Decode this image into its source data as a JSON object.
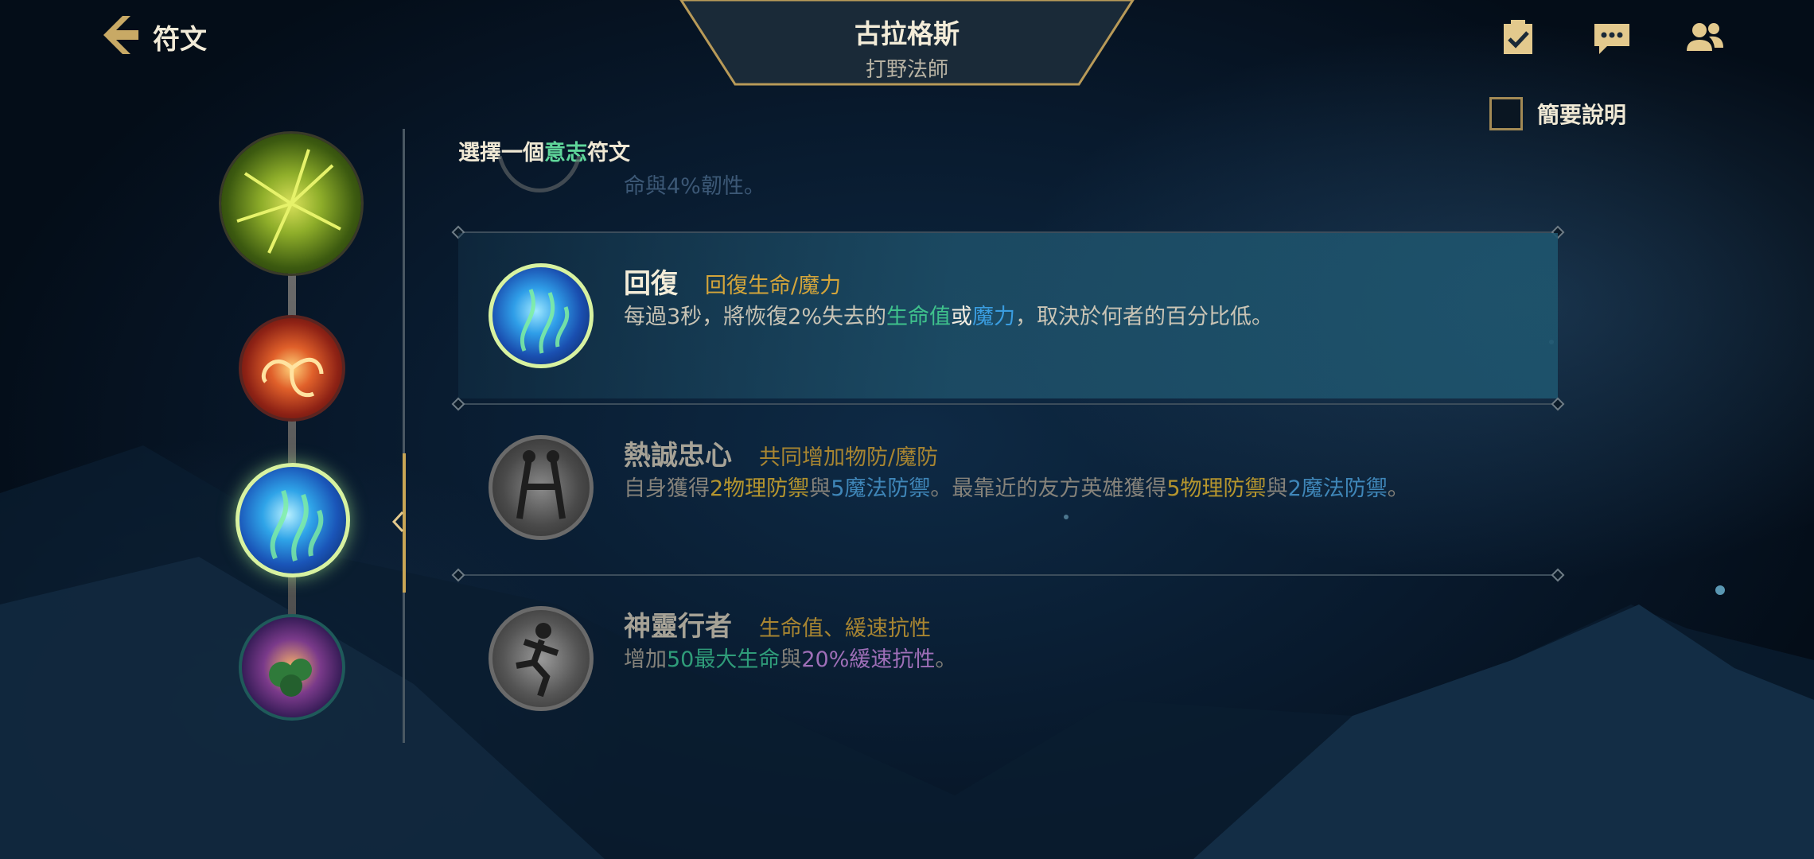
{
  "header": {
    "back_label": "符文",
    "champion_name": "古拉格斯",
    "champion_role": "打野法師",
    "summary_toggle_label": "簡要說明"
  },
  "list": {
    "header_prefix": "選擇一個",
    "header_accent": "意志",
    "header_suffix": "符文",
    "partial_text": "命與4%韌性。"
  },
  "runes": [
    {
      "name": "回復",
      "tag": "回復生命/魔力",
      "desc_parts": [
        "每過3秒，將恢復2%失去的",
        "生命值",
        "或",
        "魔力",
        "，取決於何者的百分比低。"
      ],
      "selected": true
    },
    {
      "name": "熱誠忠心",
      "tag": "共同增加物防/魔防",
      "desc_parts": [
        "自身獲得",
        "2物理防禦",
        "與",
        "5魔法防禦",
        "。最靠近的友方英雄獲得",
        "5物理防禦",
        "與",
        "2魔法防禦",
        "。"
      ],
      "selected": false
    },
    {
      "name": "神靈行者",
      "tag": "生命值、緩速抗性",
      "desc_parts": [
        "增加",
        "50最大生命",
        "與",
        "20%緩速抗性",
        "。"
      ],
      "selected": false
    }
  ],
  "colors": {
    "accent_gold": "#c9a655",
    "accent_green": "#5fd69a",
    "tag_gold": "#d4a53a",
    "life_green": "#3fc28c",
    "mana_blue": "#3a9de0"
  }
}
